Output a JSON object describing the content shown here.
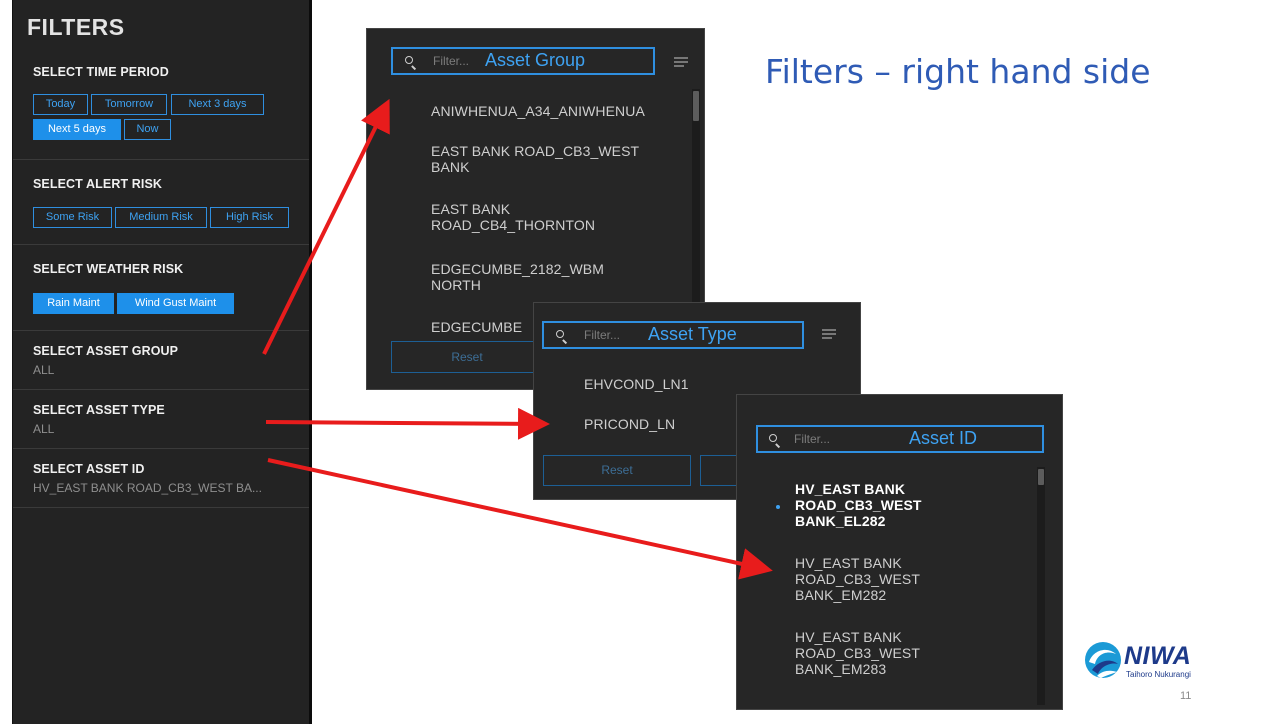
{
  "filters": {
    "title": "FILTERS",
    "time_period": {
      "title": "SELECT TIME PERIOD",
      "options": [
        {
          "label": "Today",
          "active": false
        },
        {
          "label": "Tomorrow",
          "active": false
        },
        {
          "label": "Next 3 days",
          "active": false
        },
        {
          "label": "Next 5 days",
          "active": true
        },
        {
          "label": "Now",
          "active": false
        }
      ]
    },
    "alert_risk": {
      "title": "SELECT ALERT RISK",
      "options": [
        {
          "label": "Some Risk",
          "active": false
        },
        {
          "label": "Medium Risk",
          "active": false
        },
        {
          "label": "High Risk",
          "active": false
        }
      ]
    },
    "weather_risk": {
      "title": "SELECT WEATHER RISK",
      "options": [
        {
          "label": "Rain Maint",
          "active": true
        },
        {
          "label": "Wind Gust Maint",
          "active": true
        }
      ]
    },
    "asset_group": {
      "title": "SELECT ASSET GROUP",
      "value": "ALL"
    },
    "asset_type": {
      "title": "SELECT ASSET TYPE",
      "value": "ALL"
    },
    "asset_id": {
      "title": "SELECT ASSET ID",
      "value": "HV_EAST BANK ROAD_CB3_WEST BA..."
    }
  },
  "asset_group_popup": {
    "placeholder": "Filter...",
    "label": "Asset Group",
    "options": [
      "ANIWHENUA_A34_ANIWHENUA",
      "EAST BANK ROAD_CB3_WEST BANK",
      "EAST BANK ROAD_CB4_THORNTON",
      "EDGECUMBE_2182_WBM NORTH",
      "EDGECUMBE"
    ],
    "reset_label": "Reset"
  },
  "asset_type_popup": {
    "placeholder": "Filter...",
    "label": "Asset Type",
    "options": [
      "EHVCOND_LN1",
      "PRICOND_LN"
    ],
    "reset_label": "Reset"
  },
  "asset_id_popup": {
    "placeholder": "Filter...",
    "label": "Asset ID",
    "options": [
      {
        "label": "HV_EAST BANK ROAD_CB3_WEST BANK_EL282",
        "selected": true
      },
      {
        "label": "HV_EAST BANK ROAD_CB3_WEST BANK_EM282",
        "selected": false
      },
      {
        "label": "HV_EAST BANK ROAD_CB3_WEST BANK_EM283",
        "selected": false
      }
    ]
  },
  "slide": {
    "title": "Filters – right hand side",
    "logo_name": "NIWA",
    "logo_tagline": "Taihoro Nukurangi",
    "page_number": "11"
  },
  "colors": {
    "accent": "#1e90ea",
    "panel": "#232323",
    "arrow": "#e81c1c",
    "slide_title": "#2f5bb5"
  }
}
